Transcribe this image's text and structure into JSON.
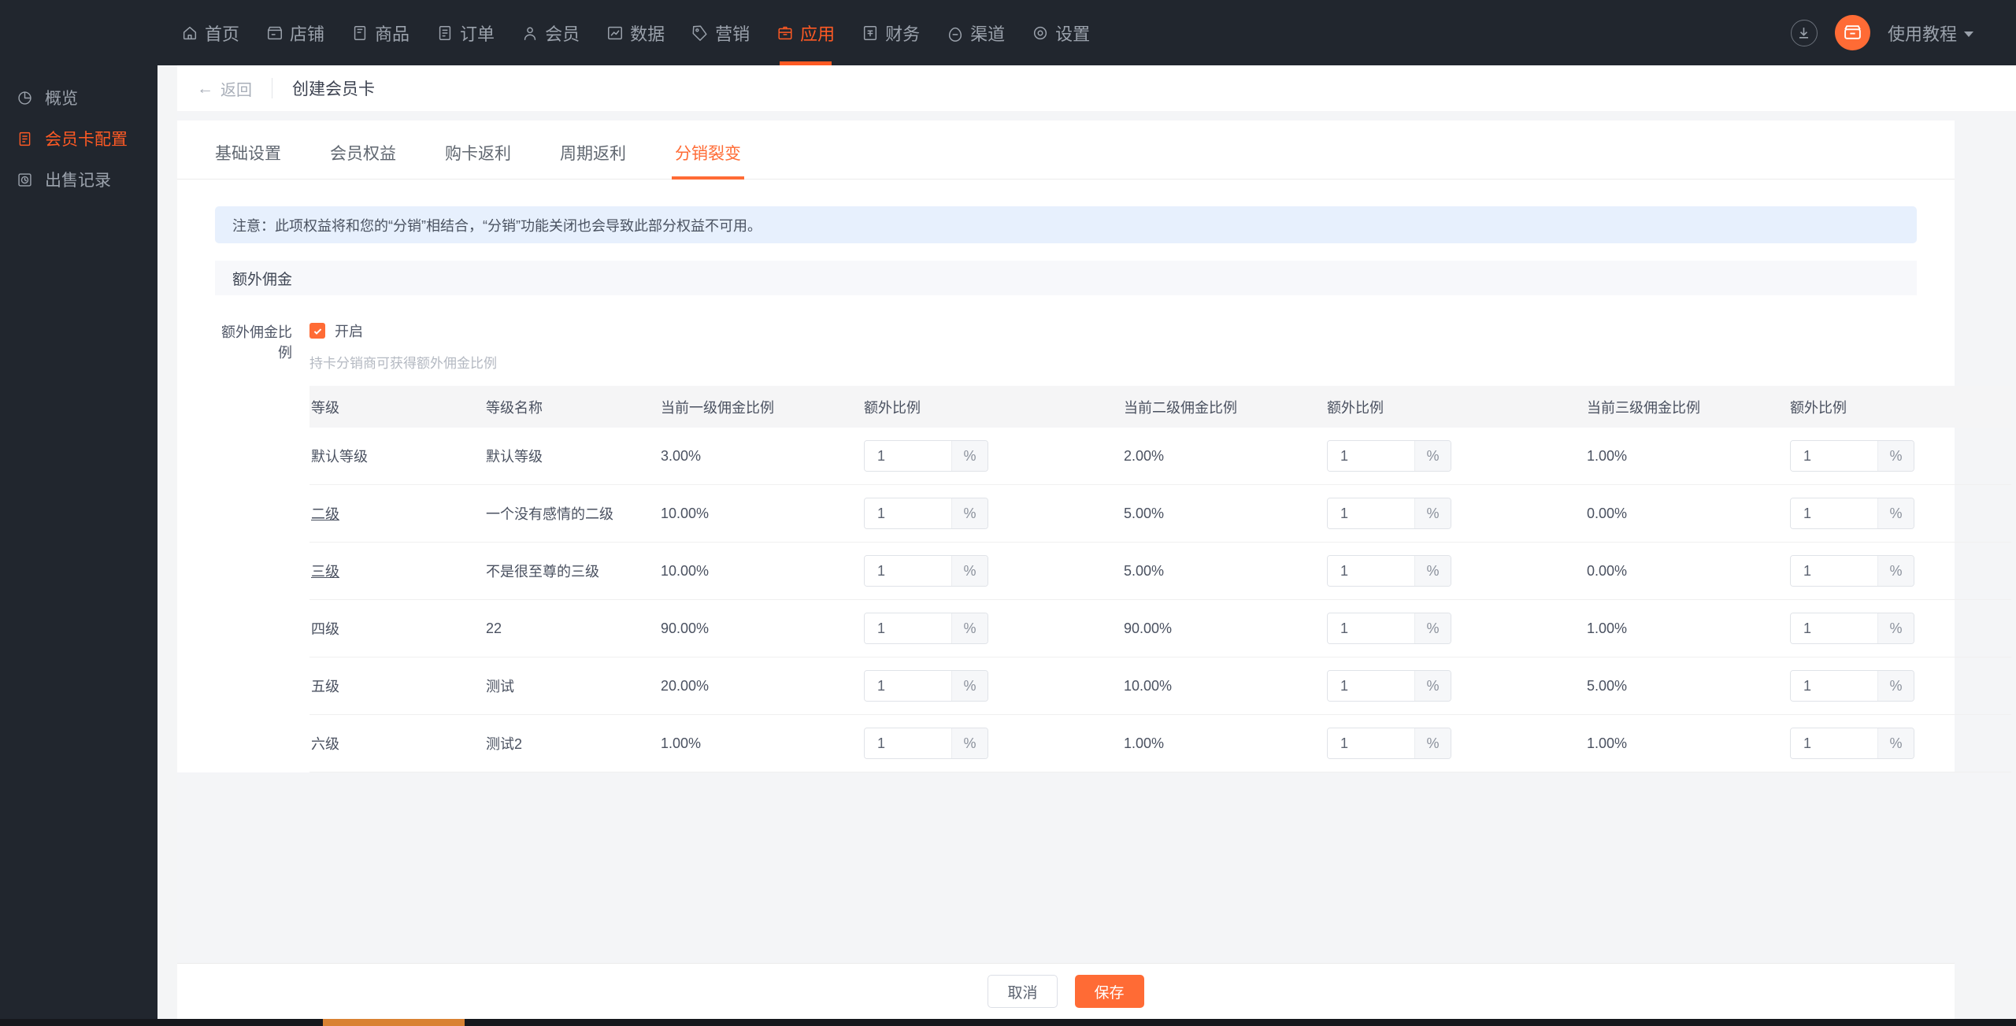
{
  "theme": {
    "accent": "#ff6b35",
    "nav_bg": "#21262e",
    "notice_bg": "#e7f0fd",
    "link": "#ff5a24"
  },
  "topnav": {
    "items": [
      {
        "label": "首页",
        "icon": "home-icon",
        "active": false
      },
      {
        "label": "店铺",
        "icon": "shop-icon",
        "active": false
      },
      {
        "label": "商品",
        "icon": "goods-icon",
        "active": false
      },
      {
        "label": "订单",
        "icon": "order-icon",
        "active": false
      },
      {
        "label": "会员",
        "icon": "member-icon",
        "active": false
      },
      {
        "label": "数据",
        "icon": "chart-icon",
        "active": false
      },
      {
        "label": "营销",
        "icon": "tag-icon",
        "active": false
      },
      {
        "label": "应用",
        "icon": "app-box-icon",
        "active": true
      },
      {
        "label": "财务",
        "icon": "finance-icon",
        "active": false
      },
      {
        "label": "渠道",
        "icon": "channel-icon",
        "active": false
      },
      {
        "label": "设置",
        "icon": "gear-icon",
        "active": false
      }
    ],
    "download_icon": "download-icon",
    "avatar_icon": "shop-avatar-icon",
    "user_label": "使用教程"
  },
  "sidebar": {
    "items": [
      {
        "label": "概览",
        "icon": "pie-chart-icon",
        "active": false
      },
      {
        "label": "会员卡配置",
        "icon": "card-config-icon",
        "active": true
      },
      {
        "label": "出售记录",
        "icon": "sale-record-icon",
        "active": false
      }
    ]
  },
  "header": {
    "back_label": "返回",
    "back_icon": "arrow-left-icon",
    "title": "创建会员卡"
  },
  "tabs": [
    {
      "label": "基础设置",
      "active": false
    },
    {
      "label": "会员权益",
      "active": false
    },
    {
      "label": "购卡返利",
      "active": false
    },
    {
      "label": "周期返利",
      "active": false
    },
    {
      "label": "分销裂变",
      "active": true
    }
  ],
  "notice": {
    "text": "注意：此项权益将和您的“分销”相结合，“分销”功能关闭也会导致此部分权益不可用。"
  },
  "section": {
    "title": "额外佣金"
  },
  "field": {
    "label": "额外佣金比例",
    "checkbox_label": "开启",
    "checkbox_checked": true,
    "hint": "持卡分销商可获得额外佣金比例"
  },
  "table": {
    "headers": [
      "等级",
      "等级名称",
      "当前一级佣金比例",
      "额外比例",
      "当前二级佣金比例",
      "额外比例",
      "当前三级佣金比例",
      "额外比例"
    ],
    "rows": [
      {
        "level": "默认等级",
        "level_link": false,
        "name": "默认等级",
        "p1": "3.00%",
        "e1": "1",
        "p2": "2.00%",
        "e2": "1",
        "p3": "1.00%",
        "e3": "1"
      },
      {
        "level": "二级",
        "level_link": true,
        "name": "一个没有感情的二级",
        "p1": "10.00%",
        "e1": "1",
        "p2": "5.00%",
        "e2": "1",
        "p3": "0.00%",
        "e3": "1"
      },
      {
        "level": "三级",
        "level_link": true,
        "name": "不是很至尊的三级",
        "p1": "10.00%",
        "e1": "1",
        "p2": "5.00%",
        "e2": "1",
        "p3": "0.00%",
        "e3": "1"
      },
      {
        "level": "四级",
        "level_link": false,
        "name": "22",
        "p1": "90.00%",
        "e1": "1",
        "p2": "90.00%",
        "e2": "1",
        "p3": "1.00%",
        "e3": "1"
      },
      {
        "level": "五级",
        "level_link": false,
        "name": "测试",
        "p1": "20.00%",
        "e1": "1",
        "p2": "10.00%",
        "e2": "1",
        "p3": "5.00%",
        "e3": "1"
      },
      {
        "level": "六级",
        "level_link": false,
        "name": "测试2",
        "p1": "1.00%",
        "e1": "1",
        "p2": "1.00%",
        "e2": "1",
        "p3": "1.00%",
        "e3": "1"
      }
    ],
    "suffix": "%"
  },
  "footer": {
    "cancel_label": "取消",
    "save_label": "保存"
  }
}
